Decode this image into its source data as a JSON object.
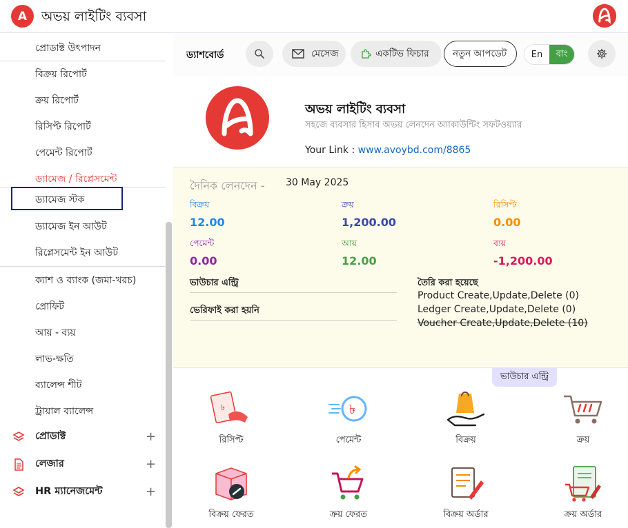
{
  "app": {
    "badge_letter": "A",
    "title": "অভয় লাইটিং ব্যবসা",
    "brand_color": "#e53935"
  },
  "sidebar": {
    "items": [
      {
        "label": "প্রোডাক্ট উৎপাদন"
      },
      {
        "label": "বিক্রয় রিপোর্ট"
      },
      {
        "label": "ক্রয় রিপোর্ট"
      },
      {
        "label": "রিসিপ্ট রিপোর্ট"
      },
      {
        "label": "পেমেন্ট রিপোর্ট"
      },
      {
        "label": "ড্যামেজ / রিপ্লেসমেন্ট"
      },
      {
        "label": "ড্যামেজ স্টক"
      },
      {
        "label": "ড্যামেজ ইন আউট"
      },
      {
        "label": "রিপ্লেসমেন্ট ইন আউট"
      },
      {
        "label": "ক্যাশ ও ব্যাংক (জমা-খরচ)"
      },
      {
        "label": "প্রোফিট"
      },
      {
        "label": "আয় - ব্যয়"
      },
      {
        "label": "লাভ-ক্ষতি"
      },
      {
        "label": "ব্যালেন্স শীট"
      },
      {
        "label": "ট্রায়াল ব্যালেন্স"
      }
    ],
    "groups": [
      {
        "label": "প্রোডাক্ট",
        "icon": "layers-icon"
      },
      {
        "label": "লেজার",
        "icon": "document-icon"
      },
      {
        "label": "HR ম্যানেজমেন্ট",
        "icon": "layers-icon"
      }
    ],
    "selected_label": "ড্যামেজ স্টক"
  },
  "navbar": {
    "dashboard": "ড্যাশবোর্ড",
    "message": "মেসেজ",
    "active_feature": "একটিভ ফিচার",
    "new_update": "নতুন আপডেট",
    "lang_en": "En",
    "lang_bn": "বাং"
  },
  "company": {
    "name": "অভয় লাইটিং ব্যবসা",
    "tagline": "সহজে ব্যবসার হিসাব অভয় লেনদেন অ্যাকাউন্টিং সফটওয়্যার",
    "link_label": "Your Link : ",
    "link": "www.avoybd.com/8865"
  },
  "summary": {
    "daily_label": "দৈনিক লেনদেন -",
    "date": "30 May 2025",
    "stats": [
      {
        "label": "বিক্রয়",
        "value": "12.00",
        "color": "#1e88e5"
      },
      {
        "label": "ক্রয়",
        "value": "1,200.00",
        "color": "#3949ab"
      },
      {
        "label": "রিসিপ্ট",
        "value": "0.00",
        "color": "#fb8c00"
      },
      {
        "label": "পেমেন্ট",
        "value": "0.00",
        "color": "#8e24aa"
      },
      {
        "label": "আয়",
        "value": "12.00",
        "color": "#43a047"
      },
      {
        "label": "ব্যয়",
        "value": "-1,200.00",
        "color": "#d81b60"
      }
    ],
    "voucher_entry": "ভাউচার এন্ট্রি",
    "not_verified": "ভেরিফাই করা হয়নি",
    "created_head": "তৈরি করা হয়েছে",
    "history": [
      "Product Create,Update,Delete (0)",
      "Ledger Create,Update,Delete (0)",
      "Voucher Create,Update,Delete (10)"
    ]
  },
  "quick": {
    "voucher_tag": "ভাউচার এন্ট্রি",
    "items": [
      {
        "label": "রিসিপ্ট",
        "icon": "receipt-icon"
      },
      {
        "label": "পেমেন্ট",
        "icon": "payment-icon"
      },
      {
        "label": "বিক্রয়",
        "icon": "sale-icon"
      },
      {
        "label": "ক্রয়",
        "icon": "cart-icon"
      },
      {
        "label": "বিক্রয় ফেরত",
        "icon": "sale-return-icon"
      },
      {
        "label": "ক্রয় ফেরত",
        "icon": "purchase-return-icon"
      },
      {
        "label": "বিক্রয় অর্ডার",
        "icon": "sale-order-icon"
      },
      {
        "label": "ক্রয় অর্ডার",
        "icon": "purchase-order-icon"
      }
    ]
  }
}
